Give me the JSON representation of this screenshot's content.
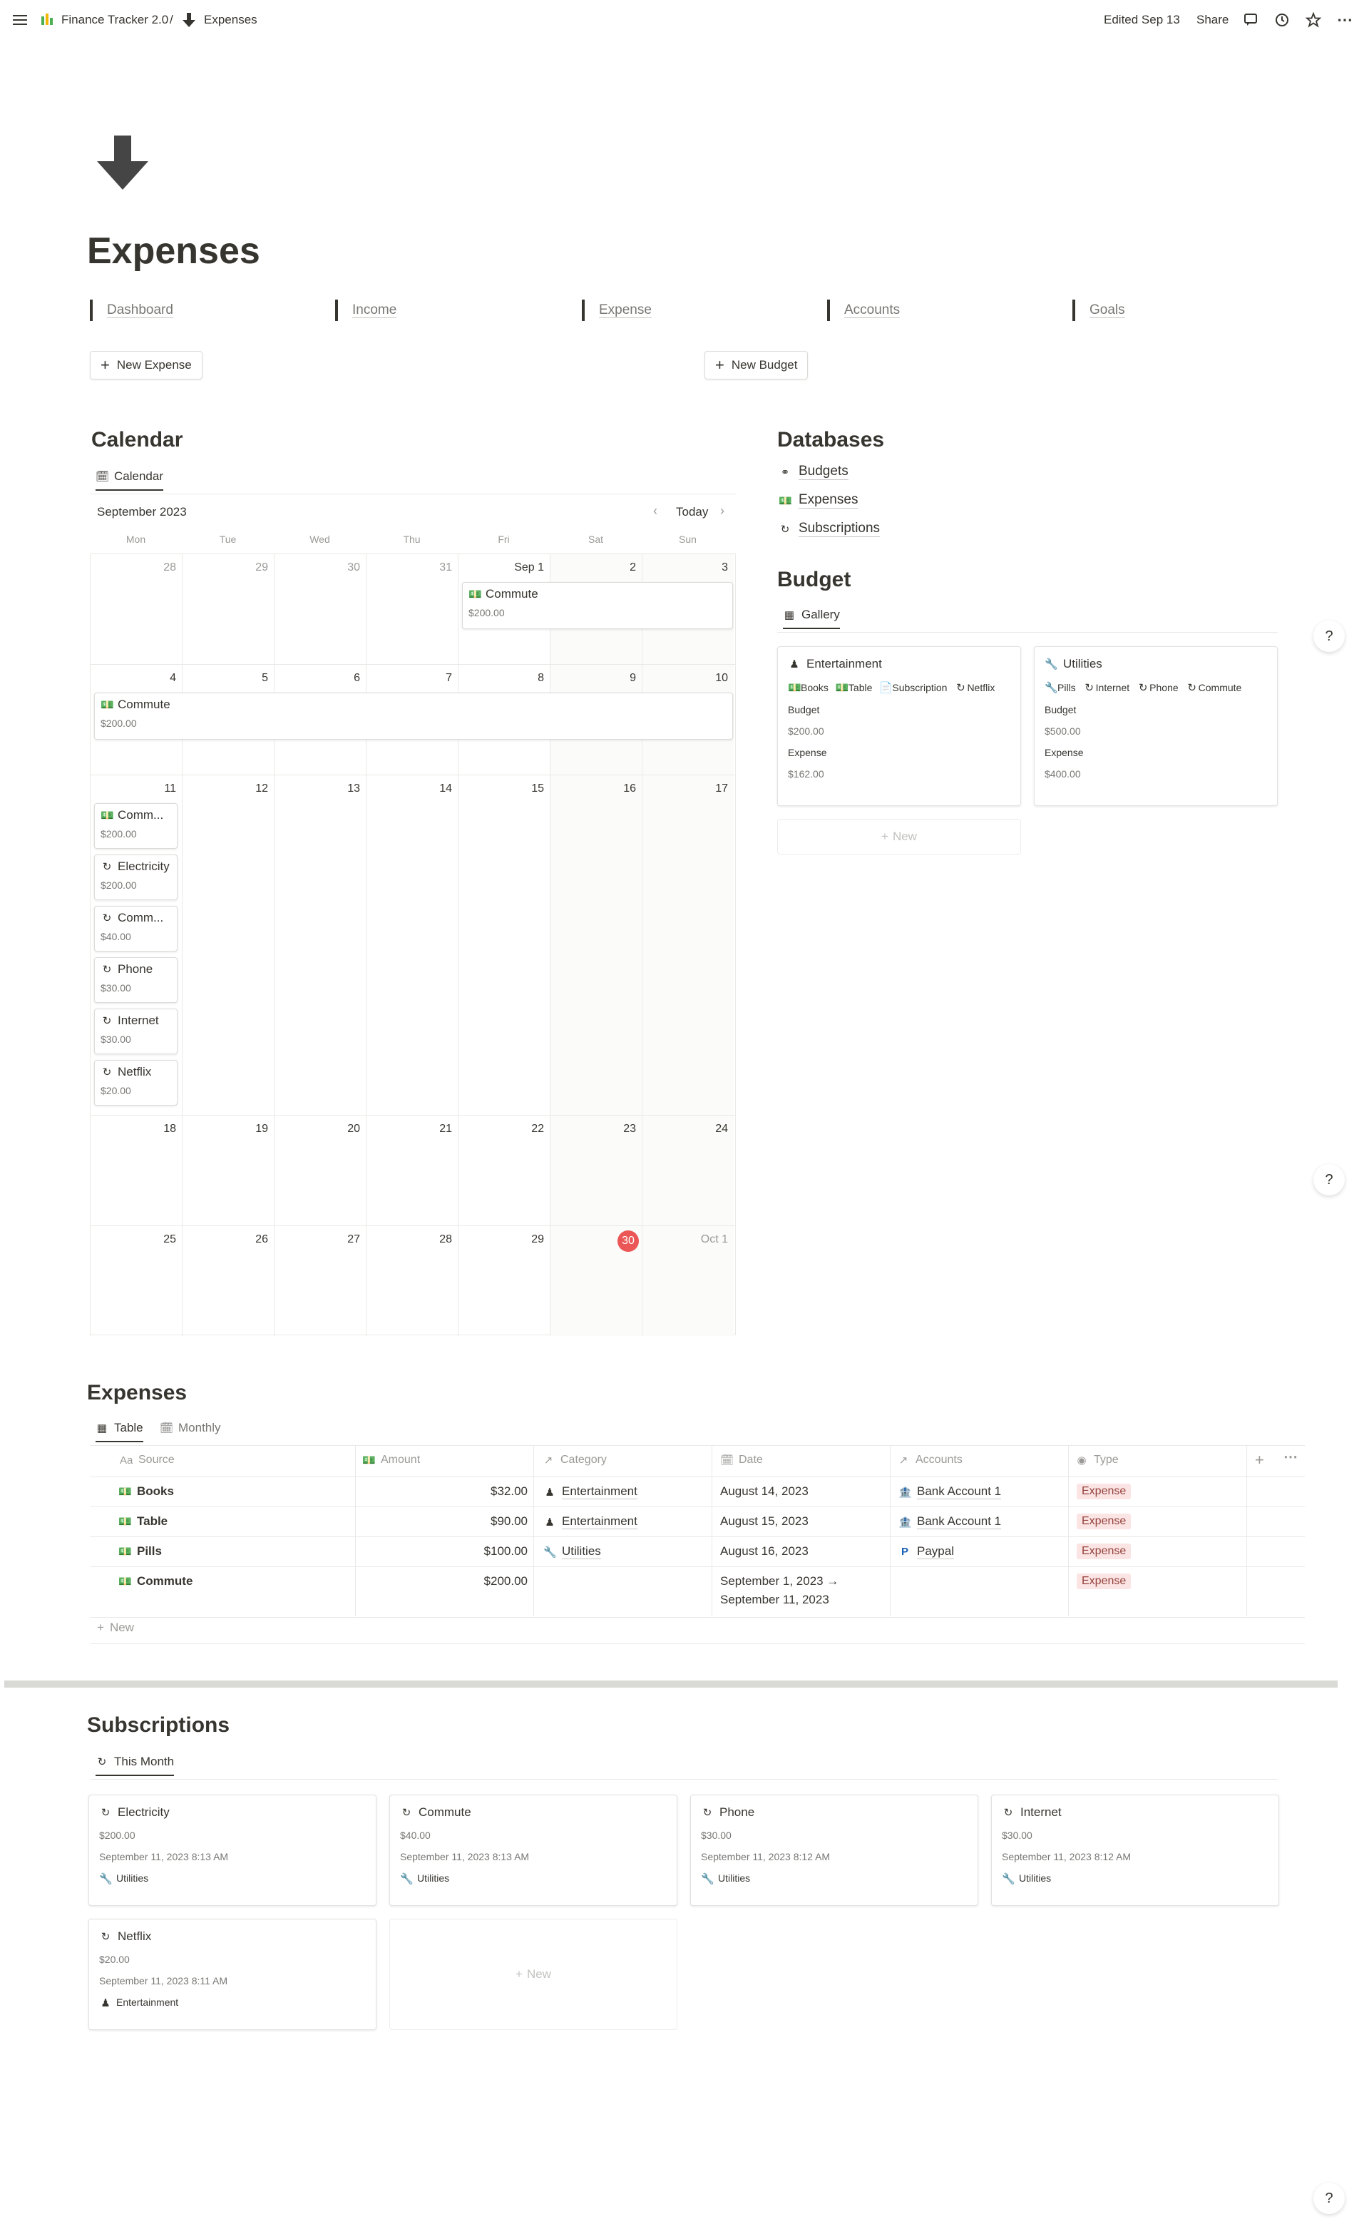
{
  "topbar": {
    "workspace": "Finance Tracker 2.0",
    "separator": "/",
    "page": "Expenses",
    "edited": "Edited Sep 13",
    "share": "Share"
  },
  "page": {
    "title": "Expenses"
  },
  "nav": [
    "Dashboard",
    "Income",
    "Expense",
    "Accounts",
    "Goals"
  ],
  "buttons": {
    "new_expense": "New Expense",
    "new_budget": "New Budget"
  },
  "calendar": {
    "heading": "Calendar",
    "tab": "Calendar",
    "month": "September 2023",
    "today": "Today",
    "days_of_week": [
      "Mon",
      "Tue",
      "Wed",
      "Thu",
      "Fri",
      "Sat",
      "Sun"
    ],
    "weeks": [
      [
        "28",
        "29",
        "30",
        "31",
        "Sep 1",
        "2",
        "3"
      ],
      [
        "4",
        "5",
        "6",
        "7",
        "8",
        "9",
        "10"
      ],
      [
        "11",
        "12",
        "13",
        "14",
        "15",
        "16",
        "17"
      ],
      [
        "18",
        "19",
        "20",
        "21",
        "22",
        "23",
        "24"
      ],
      [
        "25",
        "26",
        "27",
        "28",
        "29",
        "30",
        "Oct 1"
      ]
    ],
    "events": [
      {
        "title": "Commute",
        "amount": "$200.00"
      },
      {
        "title": "Commute",
        "amount": "$200.00"
      },
      {
        "title": "Comm...",
        "amount": "$200.00"
      },
      {
        "title": "Electricity",
        "amount": "$200.00"
      },
      {
        "title": "Comm...",
        "amount": "$40.00"
      },
      {
        "title": "Phone",
        "amount": "$30.00"
      },
      {
        "title": "Internet",
        "amount": "$30.00"
      },
      {
        "title": "Netflix",
        "amount": "$20.00"
      }
    ]
  },
  "databases": {
    "heading": "Databases",
    "items": [
      "Budgets",
      "Expenses",
      "Subscriptions"
    ]
  },
  "budget": {
    "heading": "Budget",
    "tab": "Gallery",
    "new": "New",
    "cards": [
      {
        "title": "Entertainment",
        "tags": [
          "Books",
          "Table",
          "Subscription",
          "Netflix"
        ],
        "budget_label": "Budget",
        "budget": "$200.00",
        "expense_label": "Expense",
        "expense": "$162.00"
      },
      {
        "title": "Utilities",
        "tags": [
          "Pills",
          "Internet",
          "Phone",
          "Commute"
        ],
        "budget_label": "Budget",
        "budget": "$500.00",
        "expense_label": "Expense",
        "expense": "$400.00"
      }
    ]
  },
  "expenses": {
    "heading": "Expenses",
    "tabs": [
      "Table",
      "Monthly"
    ],
    "columns": [
      "Source",
      "Amount",
      "Category",
      "Date",
      "Accounts",
      "Type"
    ],
    "rows": [
      {
        "source": "Books",
        "amount": "$32.00",
        "category": "Entertainment",
        "date": "August 14, 2023",
        "date2": "",
        "account": "Bank Account 1",
        "type": "Expense"
      },
      {
        "source": "Table",
        "amount": "$90.00",
        "category": "Entertainment",
        "date": "August 15, 2023",
        "date2": "",
        "account": "Bank Account 1",
        "type": "Expense"
      },
      {
        "source": "Pills",
        "amount": "$100.00",
        "category": "Utilities",
        "date": "August 16, 2023",
        "date2": "",
        "account": "Paypal",
        "type": "Expense"
      },
      {
        "source": "Commute",
        "amount": "$200.00",
        "category": "",
        "date": "September 1, 2023 →",
        "date2": "September 11, 2023",
        "account": "",
        "type": "Expense"
      }
    ],
    "new": "New"
  },
  "subscriptions": {
    "heading": "Subscriptions",
    "tab": "This Month",
    "new": "New",
    "cards": [
      {
        "title": "Electricity",
        "amount": "$200.00",
        "date": "September 11, 2023 8:13 AM",
        "category": "Utilities"
      },
      {
        "title": "Commute",
        "amount": "$40.00",
        "date": "September 11, 2023 8:13 AM",
        "category": "Utilities"
      },
      {
        "title": "Phone",
        "amount": "$30.00",
        "date": "September 11, 2023 8:12 AM",
        "category": "Utilities"
      },
      {
        "title": "Internet",
        "amount": "$30.00",
        "date": "September 11, 2023 8:12 AM",
        "category": "Utilities"
      },
      {
        "title": "Netflix",
        "amount": "$20.00",
        "date": "September 11, 2023 8:11 AM",
        "category": "Entertainment"
      }
    ]
  },
  "help": "?"
}
